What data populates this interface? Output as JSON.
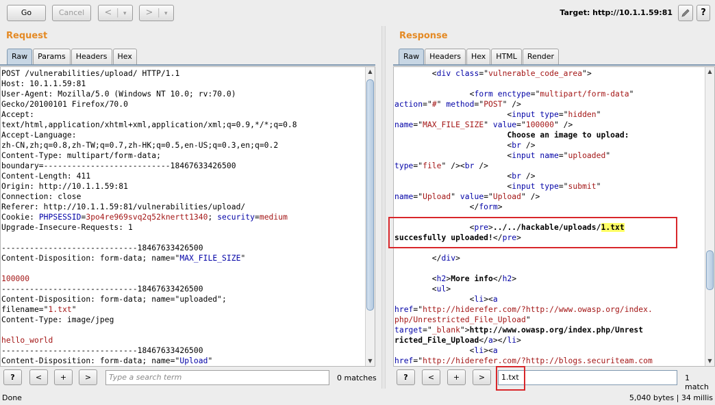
{
  "toolbar": {
    "go_label": "Go",
    "cancel_label": "Cancel",
    "back_label": "<",
    "back_dropdown": "▾",
    "fwd_label": ">",
    "fwd_dropdown": "▾",
    "target_label": "Target: http://10.1.1.59:81",
    "edit_icon": "pencil-icon",
    "help_label": "?"
  },
  "request": {
    "title": "Request",
    "tabs": [
      "Raw",
      "Params",
      "Headers",
      "Hex"
    ],
    "active_tab": "Raw",
    "search_placeholder": "Type a search term",
    "matches": "0 matches"
  },
  "response": {
    "title": "Response",
    "tabs": [
      "Raw",
      "Headers",
      "Hex",
      "HTML",
      "Render"
    ],
    "active_tab": "Raw",
    "search_value": "1.txt",
    "matches": "1 match"
  },
  "search_bar": {
    "help": "?",
    "prev": "<",
    "add": "+",
    "next": ">"
  },
  "status": {
    "left": "Done",
    "right": "5,040 bytes | 34 millis"
  },
  "colors": {
    "title": "#e48a25",
    "keyword": "#0000a6",
    "string": "#a31515",
    "highlight": "#ffff66",
    "annotation_box": "#d8262a"
  },
  "request_lines": [
    [
      {
        "t": "POST /vulnerabilities/upload/ HTTP/1.1"
      }
    ],
    [
      {
        "t": "Host: 10.1.1.59:81"
      }
    ],
    [
      {
        "t": "User-Agent: Mozilla/5.0 (Windows NT 10.0; rv:70.0)"
      }
    ],
    [
      {
        "t": "Gecko/20100101 Firefox/70.0"
      }
    ],
    [
      {
        "t": "Accept:"
      }
    ],
    [
      {
        "t": "text/html,application/xhtml+xml,application/xml;q=0.9,*/*;q=0.8"
      }
    ],
    [
      {
        "t": "Accept-Language:"
      }
    ],
    [
      {
        "t": "zh-CN,zh;q=0.8,zh-TW;q=0.7,zh-HK;q=0.5,en-US;q=0.3,en;q=0.2"
      }
    ],
    [
      {
        "t": "Content-Type: multipart/form-data;"
      }
    ],
    [
      {
        "t": "boundary=---------------------------18467633426500"
      }
    ],
    [
      {
        "t": "Content-Length: 411"
      }
    ],
    [
      {
        "t": "Origin: http://10.1.1.59:81"
      }
    ],
    [
      {
        "t": "Connection: close"
      }
    ],
    [
      {
        "t": "Referer: http://10.1.1.59:81/vulnerabilities/upload/"
      }
    ],
    [
      {
        "t": "Cookie: "
      },
      {
        "t": "PHPSESSID",
        "c": "k"
      },
      {
        "t": "="
      },
      {
        "t": "3po4re969svq2q52knertt1340",
        "c": "s"
      },
      {
        "t": "; "
      },
      {
        "t": "security",
        "c": "k"
      },
      {
        "t": "="
      },
      {
        "t": "medium",
        "c": "s"
      }
    ],
    [
      {
        "t": "Upgrade-Insecure-Requests: 1"
      }
    ],
    [
      {
        "t": ""
      }
    ],
    [
      {
        "t": "-----------------------------18467633426500"
      }
    ],
    [
      {
        "t": "Content-Disposition: form-data; name=\""
      },
      {
        "t": "MAX_FILE_SIZE",
        "c": "k"
      },
      {
        "t": "\""
      }
    ],
    [
      {
        "t": ""
      }
    ],
    [
      {
        "t": "100000",
        "c": "s"
      }
    ],
    [
      {
        "t": "-----------------------------18467633426500"
      }
    ],
    [
      {
        "t": "Content-Disposition: form-data; name=\"uploaded\";"
      }
    ],
    [
      {
        "t": "filename=\""
      },
      {
        "t": "1.txt",
        "c": "s"
      },
      {
        "t": "\""
      }
    ],
    [
      {
        "t": "Content-Type: image/jpeg"
      }
    ],
    [
      {
        "t": ""
      }
    ],
    [
      {
        "t": "hello_world",
        "c": "s"
      }
    ],
    [
      {
        "t": "-----------------------------18467633426500"
      }
    ],
    [
      {
        "t": "Content-Disposition: form-data; name=\""
      },
      {
        "t": "Upload",
        "c": "k"
      },
      {
        "t": "\""
      }
    ]
  ],
  "response_lines": [
    [
      {
        "t": "        <"
      },
      {
        "t": "div",
        "c": "k"
      },
      {
        "t": " "
      },
      {
        "t": "class",
        "c": "k"
      },
      {
        "t": "=\""
      },
      {
        "t": "vulnerable_code_area",
        "c": "s"
      },
      {
        "t": "\">"
      }
    ],
    [
      {
        "t": ""
      }
    ],
    [
      {
        "t": "                <"
      },
      {
        "t": "form",
        "c": "k"
      },
      {
        "t": " "
      },
      {
        "t": "enctype",
        "c": "k"
      },
      {
        "t": "=\""
      },
      {
        "t": "multipart/form-data",
        "c": "s"
      },
      {
        "t": "\""
      }
    ],
    [
      {
        "t": "action",
        "c": "k"
      },
      {
        "t": "=\""
      },
      {
        "t": "#",
        "c": "s"
      },
      {
        "t": "\" "
      },
      {
        "t": "method",
        "c": "k"
      },
      {
        "t": "=\""
      },
      {
        "t": "POST",
        "c": "s"
      },
      {
        "t": "\" />"
      }
    ],
    [
      {
        "t": "                        <"
      },
      {
        "t": "input",
        "c": "k"
      },
      {
        "t": " "
      },
      {
        "t": "type",
        "c": "k"
      },
      {
        "t": "=\""
      },
      {
        "t": "hidden",
        "c": "s"
      },
      {
        "t": "\""
      }
    ],
    [
      {
        "t": "name",
        "c": "k"
      },
      {
        "t": "=\""
      },
      {
        "t": "MAX_FILE_SIZE",
        "c": "s"
      },
      {
        "t": "\" "
      },
      {
        "t": "value",
        "c": "k"
      },
      {
        "t": "=\""
      },
      {
        "t": "100000",
        "c": "s"
      },
      {
        "t": "\" />"
      }
    ],
    [
      {
        "t": "                        "
      },
      {
        "t": "Choose an image to upload:",
        "c": "b"
      }
    ],
    [
      {
        "t": "                        <"
      },
      {
        "t": "br",
        "c": "k"
      },
      {
        "t": " />"
      }
    ],
    [
      {
        "t": "                        <"
      },
      {
        "t": "input",
        "c": "k"
      },
      {
        "t": " "
      },
      {
        "t": "name",
        "c": "k"
      },
      {
        "t": "=\""
      },
      {
        "t": "uploaded",
        "c": "s"
      },
      {
        "t": "\""
      }
    ],
    [
      {
        "t": "type",
        "c": "k"
      },
      {
        "t": "=\""
      },
      {
        "t": "file",
        "c": "s"
      },
      {
        "t": "\" /><"
      },
      {
        "t": "br",
        "c": "k"
      },
      {
        "t": " />"
      }
    ],
    [
      {
        "t": "                        <"
      },
      {
        "t": "br",
        "c": "k"
      },
      {
        "t": " />"
      }
    ],
    [
      {
        "t": "                        <"
      },
      {
        "t": "input",
        "c": "k"
      },
      {
        "t": " "
      },
      {
        "t": "type",
        "c": "k"
      },
      {
        "t": "=\""
      },
      {
        "t": "submit",
        "c": "s"
      },
      {
        "t": "\""
      }
    ],
    [
      {
        "t": "name",
        "c": "k"
      },
      {
        "t": "=\""
      },
      {
        "t": "Upload",
        "c": "s"
      },
      {
        "t": "\" "
      },
      {
        "t": "value",
        "c": "k"
      },
      {
        "t": "=\""
      },
      {
        "t": "Upload",
        "c": "s"
      },
      {
        "t": "\" />"
      }
    ],
    [
      {
        "t": "                </"
      },
      {
        "t": "form",
        "c": "k"
      },
      {
        "t": ">"
      }
    ],
    [
      {
        "t": ""
      }
    ],
    [
      {
        "t": "                <"
      },
      {
        "t": "pre",
        "c": "k"
      },
      {
        "t": ">"
      },
      {
        "t": "../../hackable/uploads/",
        "c": "b"
      },
      {
        "t": "1.txt",
        "c": "b hl"
      }
    ],
    [
      {
        "t": "succesfully uploaded!",
        "c": "b"
      },
      {
        "t": "</"
      },
      {
        "t": "pre",
        "c": "k"
      },
      {
        "t": ">"
      }
    ],
    [
      {
        "t": ""
      }
    ],
    [
      {
        "t": "        </"
      },
      {
        "t": "div",
        "c": "k"
      },
      {
        "t": ">"
      }
    ],
    [
      {
        "t": ""
      }
    ],
    [
      {
        "t": "        <"
      },
      {
        "t": "h2",
        "c": "k"
      },
      {
        "t": ">"
      },
      {
        "t": "More info",
        "c": "b"
      },
      {
        "t": "</"
      },
      {
        "t": "h2",
        "c": "k"
      },
      {
        "t": ">"
      }
    ],
    [
      {
        "t": "        <"
      },
      {
        "t": "ul",
        "c": "k"
      },
      {
        "t": ">"
      }
    ],
    [
      {
        "t": "                <"
      },
      {
        "t": "li",
        "c": "k"
      },
      {
        "t": "><"
      },
      {
        "t": "a",
        "c": "k"
      }
    ],
    [
      {
        "t": "href",
        "c": "k"
      },
      {
        "t": "=\""
      },
      {
        "t": "http://hiderefer.com/?http://www.owasp.org/index.",
        "c": "s"
      }
    ],
    [
      {
        "t": "php/Unrestricted_File_Upload",
        "c": "s"
      },
      {
        "t": "\""
      }
    ],
    [
      {
        "t": "target",
        "c": "k"
      },
      {
        "t": "=\""
      },
      {
        "t": "_blank",
        "c": "s"
      },
      {
        "t": "\">"
      },
      {
        "t": "http://www.owasp.org/index.php/Unrest",
        "c": "b"
      }
    ],
    [
      {
        "t": "ricted_File_Upload",
        "c": "b"
      },
      {
        "t": "</"
      },
      {
        "t": "a",
        "c": "k"
      },
      {
        "t": "></"
      },
      {
        "t": "li",
        "c": "k"
      },
      {
        "t": ">"
      }
    ],
    [
      {
        "t": "                <"
      },
      {
        "t": "li",
        "c": "k"
      },
      {
        "t": "><"
      },
      {
        "t": "a",
        "c": "k"
      }
    ],
    [
      {
        "t": "href",
        "c": "k"
      },
      {
        "t": "=\""
      },
      {
        "t": "http://hiderefer.com/?http://blogs.securiteam.com",
        "c": "s"
      }
    ]
  ]
}
